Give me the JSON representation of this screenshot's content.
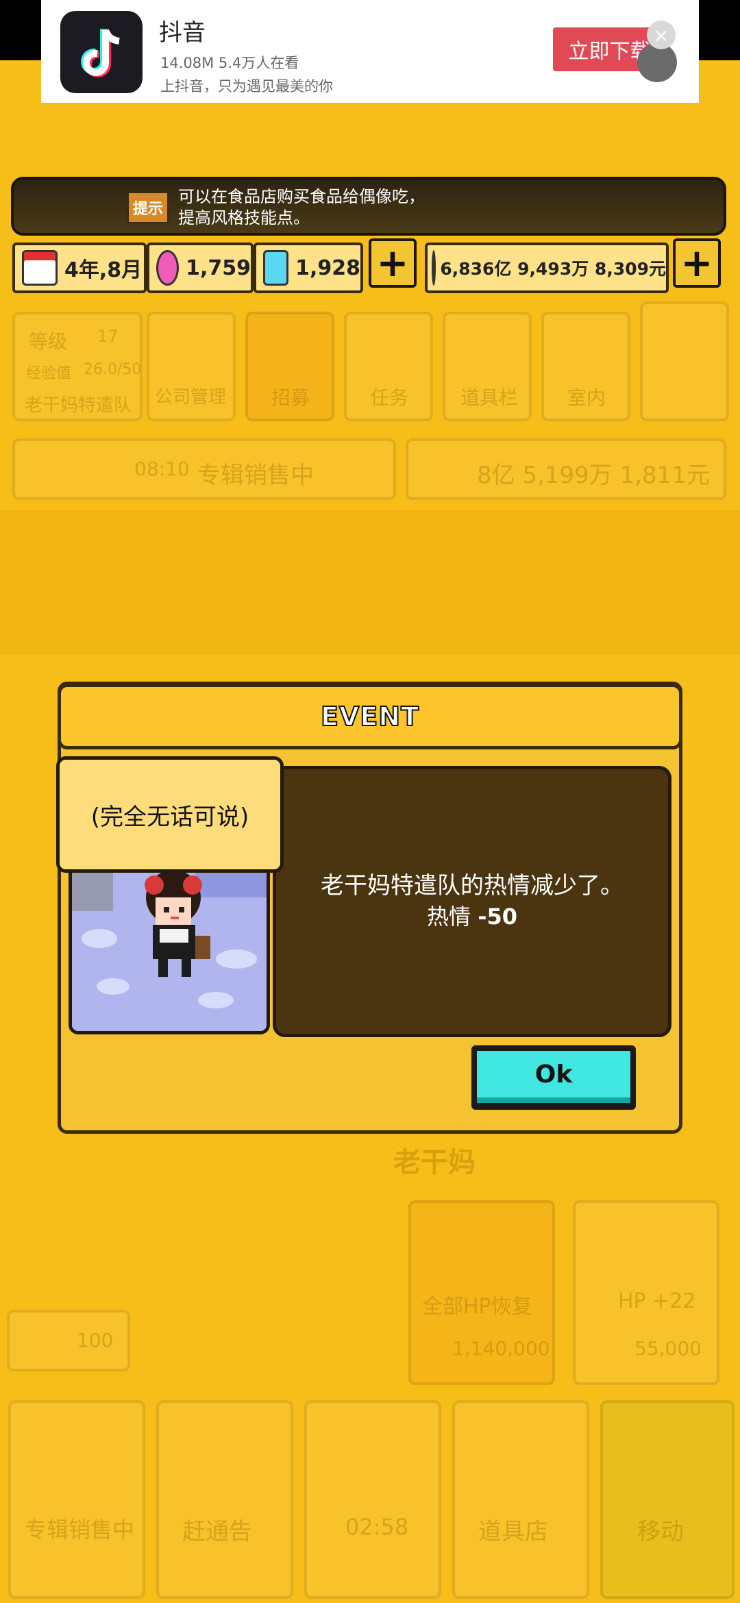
{
  "ad": {
    "app_name": "抖音",
    "stats": "14.08M 5.4万人在看",
    "tagline": "上抖音，只为遇见最美的你",
    "download_label": "立即下载",
    "close_icon": "×"
  },
  "hint": {
    "tag": "提示",
    "line1": "可以在食品店购买食品给偶像吃，",
    "line2": "提高风格技能点。"
  },
  "resources": {
    "date": "4年,8月",
    "gems_pink": "1,759",
    "gems_blue": "1,928",
    "money": "6,836亿 9,493万 8,309元",
    "plus": "+"
  },
  "background": {
    "level_label": "等级",
    "level_value": "17",
    "exp_label": "经验值",
    "exp_value": "26.0/50",
    "team_name": "老干妈特遣队",
    "menu": [
      "公司管理",
      "招募",
      "任务",
      "道具栏",
      "室内"
    ],
    "status_time": "08:10",
    "status_text": "专辑销售中",
    "status_money": "8亿 5,199万 1,811元",
    "stage_name": "老干妈",
    "shop_full_hp": "全部HP恢复",
    "shop_full_price": "1,140,000",
    "shop_hp": "HP +22",
    "shop_hp_price": "55,000",
    "count": "100",
    "bottom": [
      "专辑销售中",
      "赶通告",
      "02:58",
      "道具店",
      "移动"
    ]
  },
  "event": {
    "title": "EVENT",
    "speaker": "(完全无话可说)",
    "message": "老干妈特遣队的热情减少了。",
    "effect_label": "热情",
    "effect_value": "-50",
    "ok_label": "Ok"
  },
  "colors": {
    "background": "#f7bd18",
    "dialog": "#f5c332",
    "message_box": "#4a3510",
    "ok_button": "#40e6e0",
    "ad_button": "#e04a55"
  }
}
